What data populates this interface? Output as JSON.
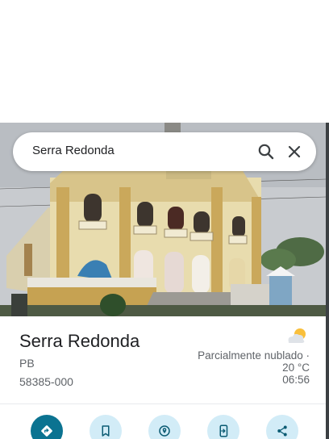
{
  "search": {
    "query": "Serra Redonda",
    "search_icon": "search-icon",
    "close_icon": "close-icon"
  },
  "place": {
    "name": "Serra Redonda",
    "state": "PB",
    "postal_code": "58385-000"
  },
  "weather": {
    "icon": "partly-cloudy-icon",
    "line1": "Parcialmente nublado ·",
    "line2": "20 °C",
    "line3": "06:56"
  },
  "actions": [
    {
      "icon": "directions-icon"
    },
    {
      "icon": "bookmark-icon"
    },
    {
      "icon": "nearby-icon"
    },
    {
      "icon": "send-to-phone-icon"
    },
    {
      "icon": "share-icon"
    }
  ],
  "colors": {
    "primary_action": "#0b7391",
    "secondary_action": "#d2ecf7",
    "action_icon": "#0b5b73"
  }
}
